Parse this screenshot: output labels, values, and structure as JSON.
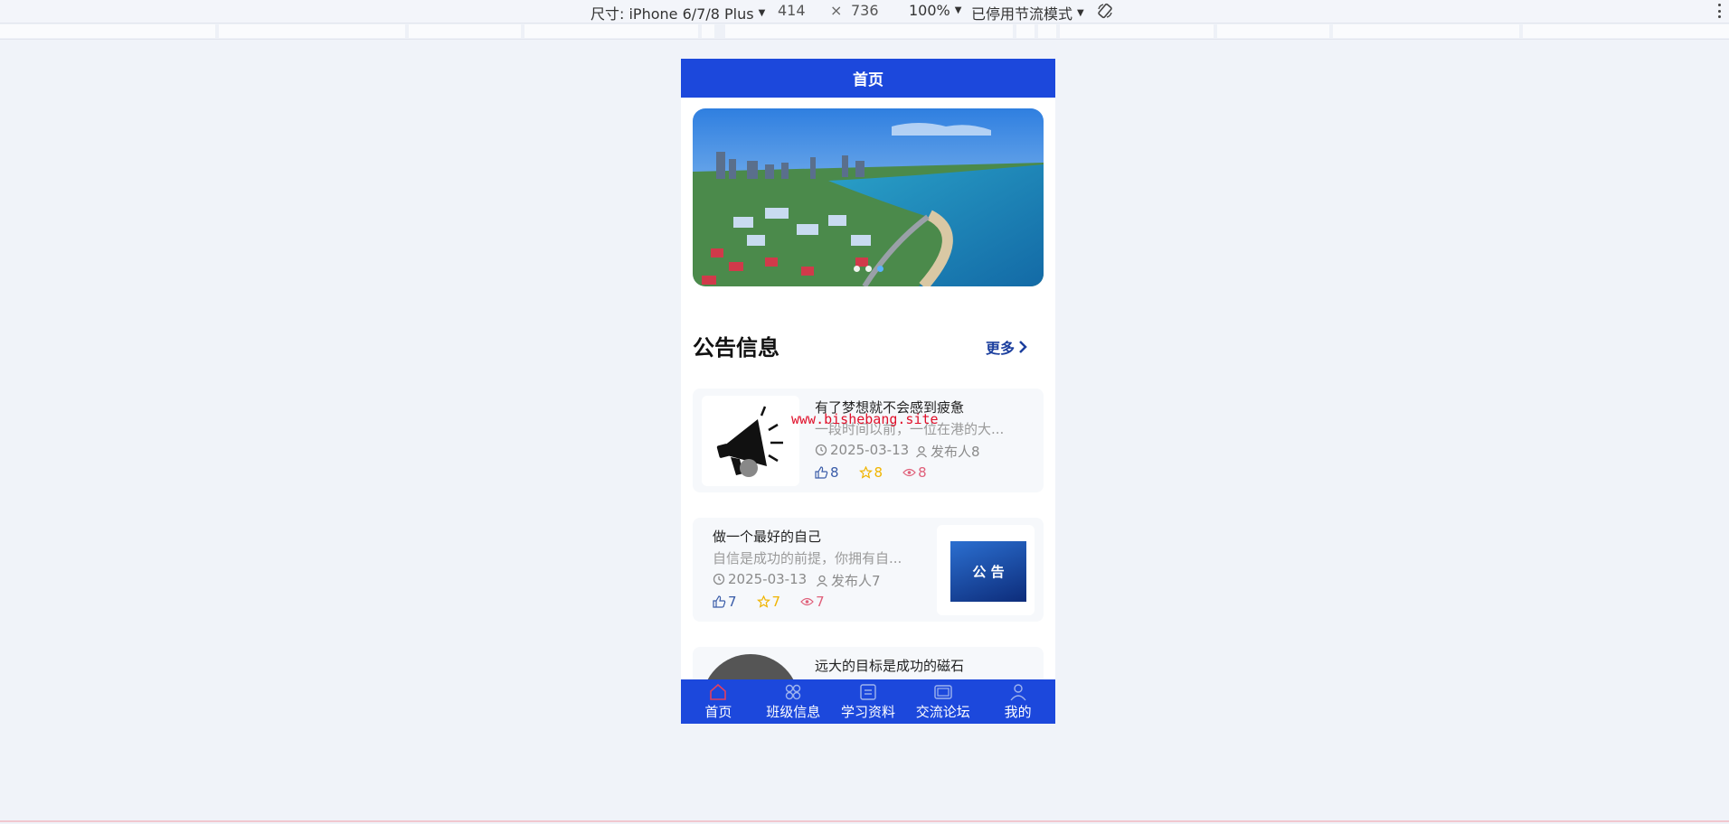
{
  "devtools": {
    "device_label": "尺寸: iPhone 6/7/8 Plus",
    "width": "414",
    "times": "×",
    "height": "736",
    "zoom": "100%",
    "throttle": "已停用节流模式",
    "rotate_icon": "rotate-icon",
    "menu_icon": "more-vertical-icon"
  },
  "app": {
    "title": "首页",
    "banner": {
      "slide_count": 3,
      "active_slide": 2
    },
    "section": {
      "title": "公告信息",
      "more_label": "更多"
    },
    "notices": [
      {
        "title": "有了梦想就不会感到疲惫",
        "desc": "一段时间以前，一位在港的大...",
        "date": "2025-03-13",
        "publisher": "发布人8",
        "likes": "8",
        "favorites": "8",
        "views": "8",
        "thumb_icon": "megaphone-icon"
      },
      {
        "title": "做一个最好的自己",
        "desc": "自信是成功的前提，你拥有自...",
        "date": "2025-03-13",
        "publisher": "发布人7",
        "likes": "7",
        "favorites": "7",
        "views": "7",
        "thumb_text": "公 告"
      },
      {
        "title": "远大的目标是成功的磁石"
      }
    ],
    "watermark": "www.bishebang.site",
    "tabs": [
      {
        "label": "首页",
        "icon": "home-icon"
      },
      {
        "label": "班级信息",
        "icon": "grid-icon"
      },
      {
        "label": "学习资料",
        "icon": "document-icon"
      },
      {
        "label": "交流论坛",
        "icon": "forum-icon"
      },
      {
        "label": "我的",
        "icon": "user-icon"
      }
    ]
  },
  "colors": {
    "brand": "#1c48dc",
    "like": "#3a5ca8",
    "favorite": "#f0b400",
    "view": "#e0607a"
  }
}
